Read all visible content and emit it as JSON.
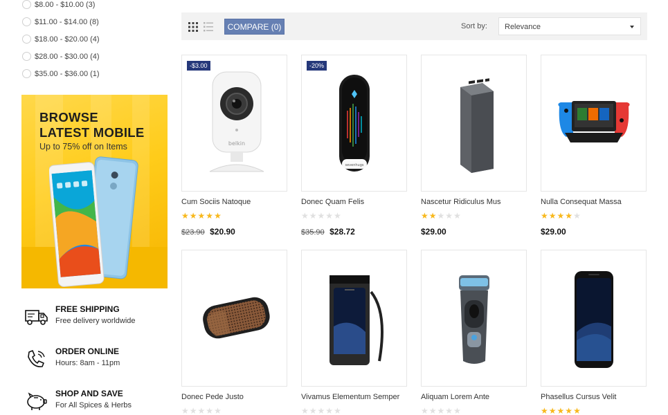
{
  "sidebar": {
    "price_filters": [
      {
        "label": "$8.00 - $10.00 (3)"
      },
      {
        "label": "$11.00 - $14.00 (8)"
      },
      {
        "label": "$18.00 - $20.00 (4)"
      },
      {
        "label": "$28.00 - $30.00 (4)"
      },
      {
        "label": "$35.00 - $36.00 (1)"
      }
    ],
    "banner": {
      "title_line1": "BROWSE",
      "title_line2": "LATEST MOBILE",
      "subtitle": "Up to 75% off on Items"
    },
    "services": [
      {
        "icon": "truck-icon",
        "title": "FREE SHIPPING",
        "desc": "Free delivery worldwide"
      },
      {
        "icon": "phone-icon",
        "title": "ORDER ONLINE",
        "desc": "Hours: 8am - 11pm"
      },
      {
        "icon": "piggy-bank-icon",
        "title": "SHOP AND SAVE",
        "desc": "For All Spices & Herbs"
      }
    ]
  },
  "toolbar": {
    "compare_label": "COMPARE (0)",
    "sort_label": "Sort by:",
    "sort_value": "Relevance"
  },
  "products": [
    {
      "name": "Cum Sociis Natoque",
      "badge": "-$3.00",
      "rating": 5,
      "old_price": "$23.90",
      "price": "$20.90",
      "image": "webcam"
    },
    {
      "name": "Donec Quam Felis",
      "badge": "-20%",
      "rating": 0,
      "old_price": "$35.90",
      "price": "$28.72",
      "image": "smart-remote"
    },
    {
      "name": "Nascetur Ridiculus Mus",
      "badge": "",
      "rating": 2,
      "old_price": "",
      "price": "$29.00",
      "image": "power-bank"
    },
    {
      "name": "Nulla Consequat Massa",
      "badge": "",
      "rating": 4,
      "old_price": "",
      "price": "$29.00",
      "image": "game-console"
    },
    {
      "name": "Donec Pede Justo",
      "badge": "",
      "rating": 0,
      "old_price": "",
      "price": "",
      "image": "speaker"
    },
    {
      "name": "Vivamus Elementum Semper",
      "badge": "",
      "rating": 0,
      "old_price": "",
      "price": "",
      "image": "waterproof-case"
    },
    {
      "name": "Aliquam Lorem Ante",
      "badge": "",
      "rating": 0,
      "old_price": "",
      "price": "",
      "image": "shaver"
    },
    {
      "name": "Phasellus Cursus Velit",
      "badge": "",
      "rating": 5,
      "old_price": "",
      "price": "",
      "image": "smartphone"
    }
  ],
  "colors": {
    "accent": "#6680b3",
    "badge": "#25387a",
    "star": "#f8b81c",
    "banner": "#ffcc1a"
  }
}
